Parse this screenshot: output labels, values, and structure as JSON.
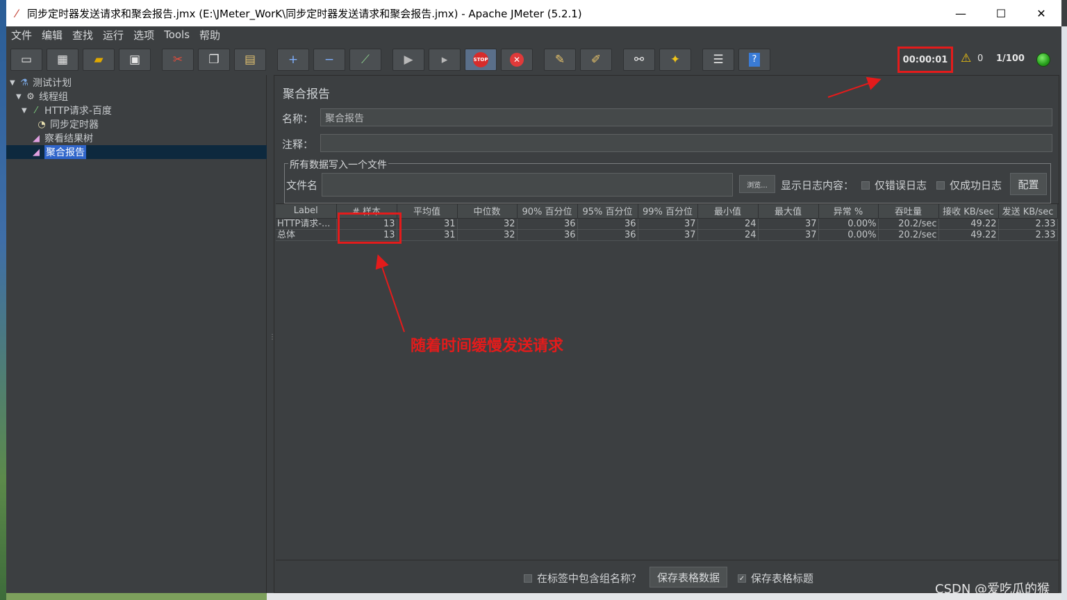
{
  "window": {
    "title": "同步定时器发送请求和聚会报告.jmx (E:\\JMeter_WorK\\同步定时器发送请求和聚会报告.jmx) - Apache JMeter (5.2.1)",
    "minimize": "—",
    "maximize": "☐",
    "close": "✕"
  },
  "menu": [
    "文件",
    "编辑",
    "查找",
    "运行",
    "选项",
    "Tools",
    "帮助"
  ],
  "toolbar": {
    "elapsed_time": "00:00:01",
    "warning_count": "0",
    "threads": "1/100",
    "icons": [
      "new-icon",
      "templates-icon",
      "open-icon",
      "save-icon",
      "cut-icon",
      "copy-icon",
      "paste-icon",
      "expand-icon",
      "collapse-icon",
      "toggle-icon",
      "start-icon",
      "start-no-pause-icon",
      "stop-icon",
      "shutdown-icon",
      "clear-icon",
      "clear-all-icon",
      "search-icon",
      "reset-search-icon",
      "function-helper-icon",
      "help-icon"
    ]
  },
  "tree": {
    "items": [
      {
        "label": "测试计划",
        "icon": "flask-icon"
      },
      {
        "label": "线程组",
        "icon": "gear-icon"
      },
      {
        "label": "HTTP请求-百度",
        "icon": "pipette-icon"
      },
      {
        "label": "同步定时器",
        "icon": "stopwatch-icon"
      },
      {
        "label": "察看结果树",
        "icon": "graph-icon"
      },
      {
        "label": "聚合报告",
        "icon": "graph-icon"
      }
    ]
  },
  "report": {
    "title": "聚合报告",
    "name_label": "名称：",
    "name_value": "聚合报告",
    "comment_label": "注释：",
    "comment_value": "",
    "file_group_label": "所有数据写入一个文件",
    "file_label": "文件名",
    "file_value": "",
    "browse_label": "浏览...",
    "log_label": "显示日志内容：",
    "errors_only_label": "仅错误日志",
    "success_only_label": "仅成功日志",
    "configure_label": "配置"
  },
  "table": {
    "columns": [
      "Label",
      "# 样本",
      "平均值",
      "中位数",
      "90% 百分位",
      "95% 百分位",
      "99% 百分位",
      "最小值",
      "最大值",
      "异常 %",
      "吞吐量",
      "接收 KB/sec",
      "发送 KB/sec"
    ],
    "rows": [
      [
        "HTTP请求-...",
        "13",
        "31",
        "32",
        "36",
        "36",
        "37",
        "24",
        "37",
        "0.00%",
        "20.2/sec",
        "49.22",
        "2.33"
      ],
      [
        "总体",
        "13",
        "31",
        "32",
        "36",
        "36",
        "37",
        "24",
        "37",
        "0.00%",
        "20.2/sec",
        "49.22",
        "2.33"
      ]
    ]
  },
  "bottom": {
    "include_group_label": "在标签中包含组名称？",
    "save_table_data_label": "保存表格数据",
    "save_table_header_label": "保存表格标题",
    "save_table_header_checked": true
  },
  "annotation": {
    "text": "随着时间缓慢发送请求",
    "color": "#e41b1b"
  },
  "watermark": "CSDN @爱吃瓜的猴"
}
